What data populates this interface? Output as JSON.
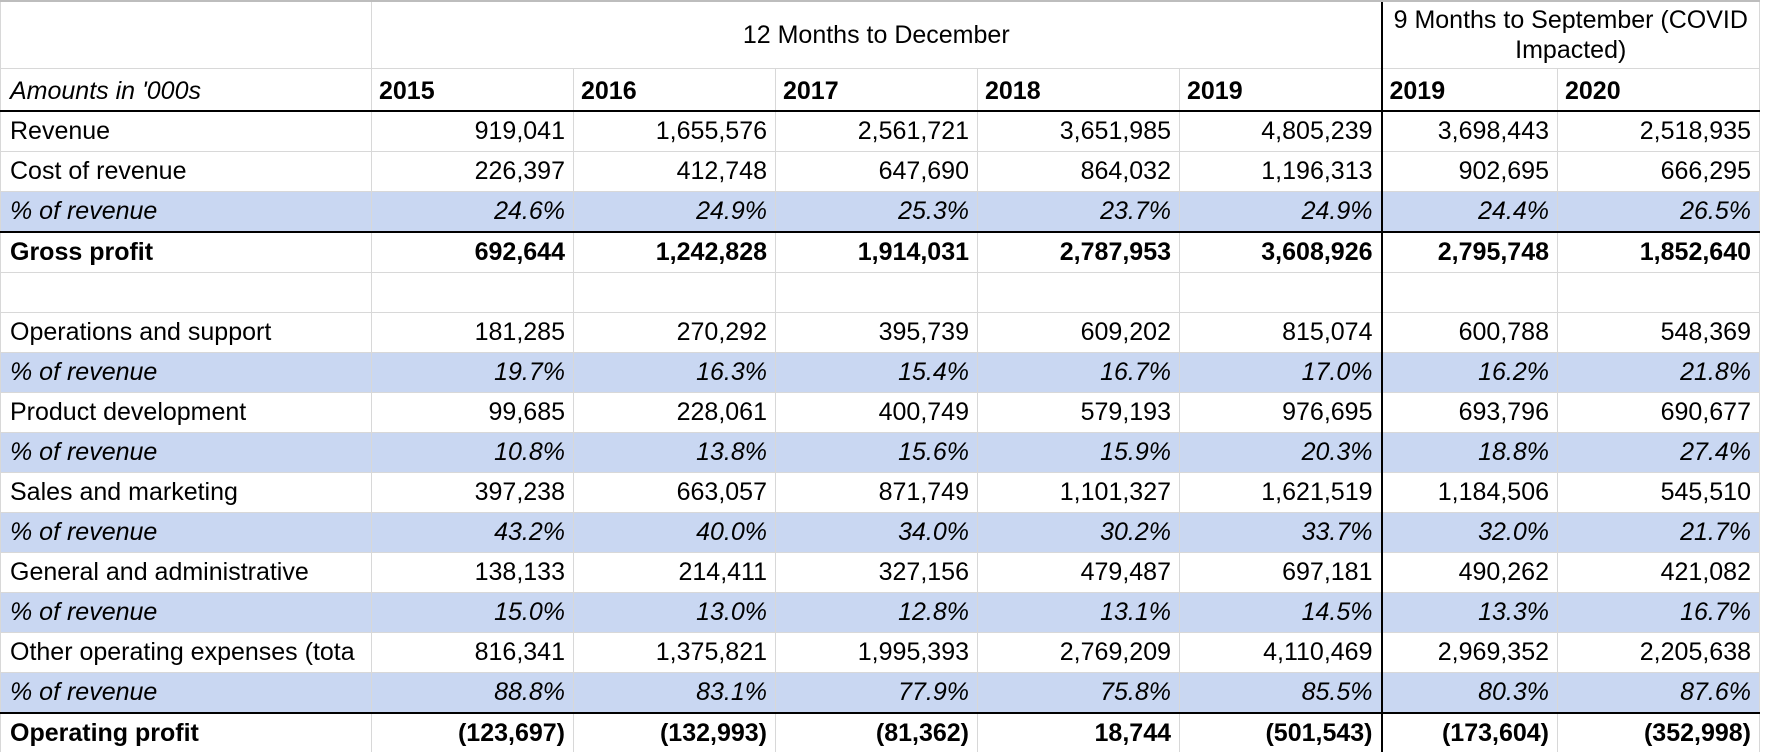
{
  "header": {
    "group_12m": "12 Months to December",
    "group_9m": "9 Months to September (COVID Impacted)",
    "units_label": "Amounts in '000s",
    "years": [
      "2015",
      "2016",
      "2017",
      "2018",
      "2019",
      "2019",
      "2020"
    ]
  },
  "rows": [
    {
      "label": "Revenue",
      "kind": "normal",
      "values": [
        "919,041",
        "1,655,576",
        "2,561,721",
        "3,651,985",
        "4,805,239",
        "3,698,443",
        "2,518,935"
      ]
    },
    {
      "label": "Cost of revenue",
      "kind": "normal",
      "values": [
        "226,397",
        "412,748",
        "647,690",
        "864,032",
        "1,196,313",
        "902,695",
        "666,295"
      ]
    },
    {
      "label": "% of revenue",
      "kind": "pct",
      "values": [
        "24.6%",
        "24.9%",
        "25.3%",
        "23.7%",
        "24.9%",
        "24.4%",
        "26.5%"
      ]
    },
    {
      "label": "Gross profit",
      "kind": "bold",
      "values": [
        "692,644",
        "1,242,828",
        "1,914,031",
        "2,787,953",
        "3,608,926",
        "2,795,748",
        "1,852,640"
      ]
    },
    {
      "label": "",
      "kind": "spacer",
      "values": [
        "",
        "",
        "",
        "",
        "",
        "",
        ""
      ]
    },
    {
      "label": "Operations and support",
      "kind": "normal",
      "values": [
        "181,285",
        "270,292",
        "395,739",
        "609,202",
        "815,074",
        "600,788",
        "548,369"
      ]
    },
    {
      "label": "% of revenue",
      "kind": "pct",
      "values": [
        "19.7%",
        "16.3%",
        "15.4%",
        "16.7%",
        "17.0%",
        "16.2%",
        "21.8%"
      ]
    },
    {
      "label": "Product development",
      "kind": "normal",
      "values": [
        "99,685",
        "228,061",
        "400,749",
        "579,193",
        "976,695",
        "693,796",
        "690,677"
      ]
    },
    {
      "label": "% of revenue",
      "kind": "pct",
      "values": [
        "10.8%",
        "13.8%",
        "15.6%",
        "15.9%",
        "20.3%",
        "18.8%",
        "27.4%"
      ]
    },
    {
      "label": "Sales and marketing",
      "kind": "normal",
      "values": [
        "397,238",
        "663,057",
        "871,749",
        "1,101,327",
        "1,621,519",
        "1,184,506",
        "545,510"
      ]
    },
    {
      "label": "% of revenue",
      "kind": "pct",
      "values": [
        "43.2%",
        "40.0%",
        "34.0%",
        "30.2%",
        "33.7%",
        "32.0%",
        "21.7%"
      ]
    },
    {
      "label": "General and administrative",
      "kind": "normal",
      "values": [
        "138,133",
        "214,411",
        "327,156",
        "479,487",
        "697,181",
        "490,262",
        "421,082"
      ]
    },
    {
      "label": "% of revenue",
      "kind": "pct",
      "values": [
        "15.0%",
        "13.0%",
        "12.8%",
        "13.1%",
        "14.5%",
        "13.3%",
        "16.7%"
      ]
    },
    {
      "label": "Other operating expenses (tota",
      "kind": "normal",
      "values": [
        "816,341",
        "1,375,821",
        "1,995,393",
        "2,769,209",
        "4,110,469",
        "2,969,352",
        "2,205,638"
      ]
    },
    {
      "label": "% of revenue",
      "kind": "pct",
      "values": [
        "88.8%",
        "83.1%",
        "77.9%",
        "75.8%",
        "85.5%",
        "80.3%",
        "87.6%"
      ]
    },
    {
      "label": "Operating profit",
      "kind": "bold",
      "values": [
        "(123,697)",
        "(132,993)",
        "(81,362)",
        "18,744",
        "(501,543)",
        "(173,604)",
        "(352,998)"
      ]
    }
  ],
  "colors": {
    "pct_row_fill": "#c9d7f2",
    "grid_line": "#d8d8d8",
    "rule": "#000000"
  }
}
